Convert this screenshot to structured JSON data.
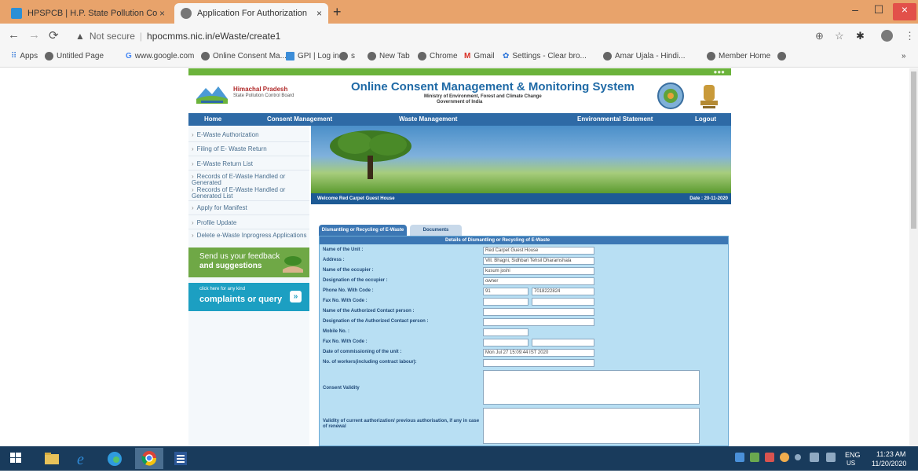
{
  "browser": {
    "tabs": [
      {
        "title": "HPSPCB | H.P. State Pollution Co",
        "close": "×",
        "favicon_color": "#2c8fd6"
      },
      {
        "title": "Application For Authorization",
        "close": "×",
        "favicon_color": "#777777"
      }
    ],
    "new_tab": "+",
    "window_controls": {
      "minimize": "–",
      "maximize": "☐",
      "close": "×"
    },
    "address": {
      "security": "Not secure",
      "host": "hpocmms.nic.in/eWaste/create1"
    },
    "bookmarks": [
      "Apps",
      "Untitled Page",
      "www.google.com",
      "Online Consent Ma...",
      "GPI | Log in",
      "s",
      "New Tab",
      "Chrome",
      "Gmail",
      "Settings - Clear bro...",
      "Amar Ujala - Hindi...",
      "Member Home",
      "»"
    ]
  },
  "site": {
    "org_name": "Himachal Pradesh",
    "org_sub": "State Pollution Control Board",
    "title": "Online Consent Management & Monitoring System",
    "ministry_line1": "Ministry of Environment, Forest and Climate Change",
    "ministry_line2": "Government of India",
    "nav": [
      "Home",
      "Consent Management",
      "Waste Management",
      "Environmental Statement",
      "Logout"
    ],
    "sidebar": [
      "E-Waste Authorization",
      "Filing of E- Waste Return",
      "E-Waste Return List",
      "Records of E-Waste Handled or Generated",
      "Records of E-Waste Handled or Generated List",
      "Apply for Manifest",
      "Profile Update",
      "Delete e-Waste Inprogress Applications"
    ],
    "feedback": {
      "line1": "Send us your feedback",
      "line2": "and suggestions"
    },
    "complaints": {
      "line1": "click here for any kind",
      "line2": "complaints or query",
      "icon": "»"
    },
    "welcome": "Welcome Red Carpet Guest House",
    "date": "Date : 20-11-2020",
    "tabs": [
      "Dismantling or Recycling of E-Waste",
      "Documents"
    ],
    "form": {
      "heading": "Details of Dismantling or Recycling of E-Waste",
      "fields": [
        {
          "label": "Name of the Unit :",
          "value": "Red Carpet Guest House"
        },
        {
          "label": "Address :",
          "value": "Vill. Bhagni, Sidhbari Tehsil Dharamshala"
        },
        {
          "label": "Name of the occupier :",
          "value": "kusum joshi"
        },
        {
          "label": "Designation of the occupier :",
          "value": "owner"
        },
        {
          "label": "Phone No. With Code :",
          "value": "91",
          "value2": "7018222824"
        },
        {
          "label": "Fax No. With Code :",
          "value": "",
          "value2": ""
        },
        {
          "label": "Name of the Authorized Contact person :",
          "value": ""
        },
        {
          "label": "Designation of the Authorized Contact person :",
          "value": ""
        },
        {
          "label": "Mobile No. :",
          "value": ""
        },
        {
          "label": "Fax No. With Code :",
          "value": "",
          "value2": ""
        },
        {
          "label": "Date of commissioning of the unit :",
          "value": "Mon Jul 27 15:09:44 IST 2020"
        },
        {
          "label": "No. of workers(including contract labour):",
          "value": ""
        },
        {
          "label": "Consent Validity",
          "value": ""
        },
        {
          "label": "Validity of current authorization/ previous authorisation, if any in case of renewal",
          "value": ""
        }
      ]
    }
  },
  "taskbar": {
    "lang1": "ENG",
    "lang2": "US",
    "time": "11:23 AM",
    "date": "11/20/2020"
  }
}
